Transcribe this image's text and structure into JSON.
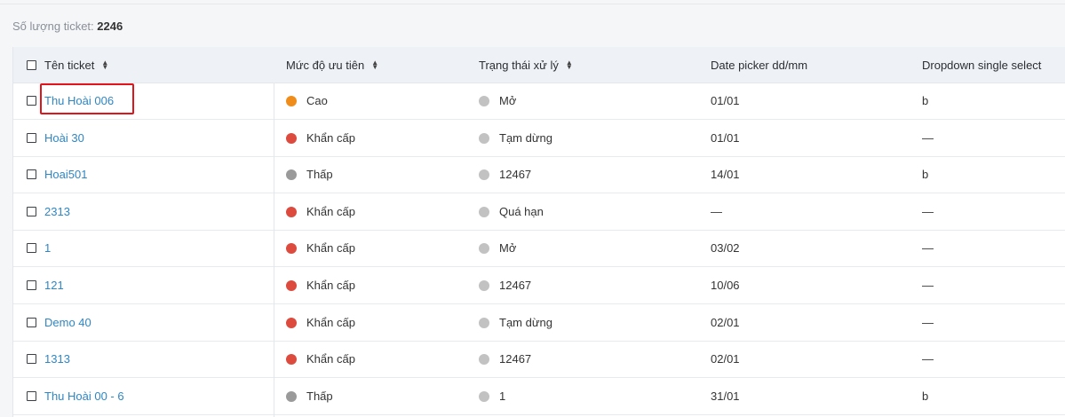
{
  "summary": {
    "label": "Số lượng ticket:",
    "count": "2246"
  },
  "columns": {
    "name": "Tên ticket",
    "priority": "Mức độ ưu tiên",
    "status": "Trạng thái xử lý",
    "date": "Date picker dd/mm",
    "dropdown": "Dropdown single select"
  },
  "sort_icon": "sort-updown-icon",
  "colors": {
    "orange": "#f08c1a",
    "red": "#dc4b3e",
    "gray": "#9a9a9a",
    "status_gray": "#c2c2c2",
    "link": "#2f86c5",
    "highlight": "#e1141c"
  },
  "rows": [
    {
      "name": "Thu Hoài 006",
      "priority": "Cao",
      "priority_color": "#f08c1a",
      "status": "Mở",
      "date": "01/01",
      "dropdown": "b"
    },
    {
      "name": "Hoài 30",
      "priority": "Khẩn cấp",
      "priority_color": "#dc4b3e",
      "status": "Tạm dừng",
      "date": "01/01",
      "dropdown": "—"
    },
    {
      "name": "Hoai501",
      "priority": "Thấp",
      "priority_color": "#9a9a9a",
      "status": "12467",
      "date": "14/01",
      "dropdown": "b"
    },
    {
      "name": "2313",
      "priority": "Khẩn cấp",
      "priority_color": "#dc4b3e",
      "status": "Quá hạn",
      "date": "—",
      "dropdown": "—"
    },
    {
      "name": "1",
      "priority": "Khẩn cấp",
      "priority_color": "#dc4b3e",
      "status": "Mở",
      "date": "03/02",
      "dropdown": "—"
    },
    {
      "name": "121",
      "priority": "Khẩn cấp",
      "priority_color": "#dc4b3e",
      "status": "12467",
      "date": "10/06",
      "dropdown": "—"
    },
    {
      "name": "Demo 40",
      "priority": "Khẩn cấp",
      "priority_color": "#dc4b3e",
      "status": "Tạm dừng",
      "date": "02/01",
      "dropdown": "—"
    },
    {
      "name": "1313",
      "priority": "Khẩn cấp",
      "priority_color": "#dc4b3e",
      "status": "12467",
      "date": "02/01",
      "dropdown": "—"
    },
    {
      "name": "Thu Hoài 00 - 6",
      "priority": "Thấp",
      "priority_color": "#9a9a9a",
      "status": "1",
      "date": "31/01",
      "dropdown": "b"
    }
  ]
}
